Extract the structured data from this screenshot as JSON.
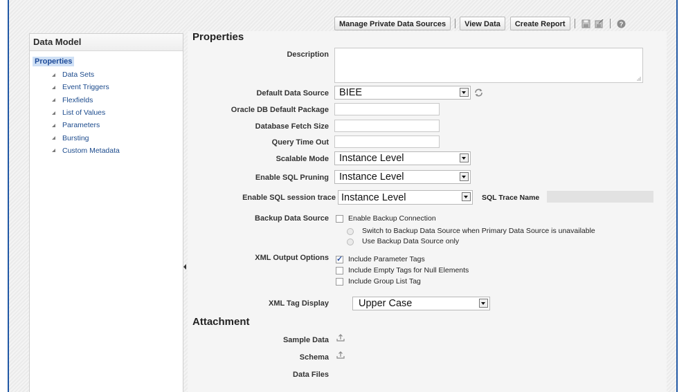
{
  "toolbar": {
    "manage_private_data_sources": "Manage Private Data Sources",
    "view_data": "View Data",
    "create_report": "Create Report",
    "icons": [
      "save-icon",
      "save-as-icon",
      "help-icon"
    ]
  },
  "sidebar": {
    "title": "Data Model",
    "root": "Properties",
    "items": [
      {
        "label": "Data Sets"
      },
      {
        "label": "Event Triggers"
      },
      {
        "label": "Flexfields"
      },
      {
        "label": "List of Values"
      },
      {
        "label": "Parameters"
      },
      {
        "label": "Bursting"
      },
      {
        "label": "Custom Metadata"
      }
    ]
  },
  "properties": {
    "title": "Properties",
    "description_label": "Description",
    "description_value": "",
    "default_data_source_label": "Default Data Source",
    "default_data_source_value": "BIEE",
    "oracle_db_default_package_label": "Oracle DB Default Package",
    "database_fetch_size_label": "Database Fetch Size",
    "query_time_out_label": "Query Time Out",
    "scalable_mode_label": "Scalable Mode",
    "scalable_mode_value": "Instance Level",
    "enable_sql_pruning_label": "Enable SQL Pruning",
    "enable_sql_pruning_value": "Instance Level",
    "enable_sql_session_trace_label": "Enable SQL session trace",
    "enable_sql_session_trace_value": "Instance Level",
    "sql_trace_name_label": "SQL Trace Name",
    "backup_data_source_label": "Backup Data Source",
    "enable_backup_connection": "Enable Backup Connection",
    "switch_to_backup": "Switch to Backup Data Source when Primary Data Source is unavailable",
    "use_backup_only": "Use Backup Data Source only",
    "xml_output_options_label": "XML Output Options",
    "include_parameter_tags": "Include Parameter Tags",
    "include_parameter_tags_checked": true,
    "include_empty_tags": "Include Empty Tags for Null Elements",
    "include_group_list_tag": "Include Group List Tag",
    "xml_tag_display_label": "XML Tag Display",
    "xml_tag_display_value": "Upper Case"
  },
  "attachment": {
    "title": "Attachment",
    "sample_data_label": "Sample Data",
    "schema_label": "Schema",
    "data_files_label": "Data Files"
  },
  "colors": {
    "frame_blue": "#1f57a4",
    "link_blue": "#1b4a8c",
    "selected_bg": "#cfe0f5"
  }
}
